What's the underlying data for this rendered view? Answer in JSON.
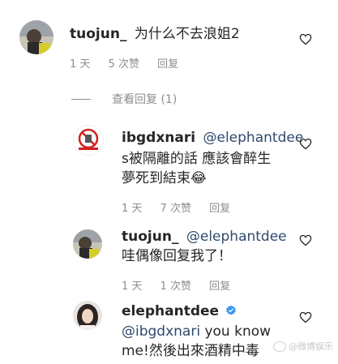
{
  "comments": [
    {
      "username": "tuojun_",
      "text": "为什么不去浪姐2",
      "time": "1 天",
      "likes": "5 次赞",
      "reply": "回复"
    }
  ],
  "view_replies": "查看回复 (1)",
  "replies": [
    {
      "username": "ibgdxnari",
      "mention": "@elephantdee",
      "line1_rest": "",
      "line2": "s被隔離的話 應該會醉生",
      "line3": "夢死到結束😂",
      "time": "1 天",
      "likes": "7 次赞",
      "reply": "回复"
    },
    {
      "username": "tuojun_",
      "mention": "@elephantdee",
      "line2": "哇偶像回复我了！",
      "time": "1 天",
      "likes": "1 次赞",
      "reply": "回复"
    },
    {
      "username": "elephantdee",
      "verified": true,
      "mention": "@ibgdxnari",
      "line2_rest": " you know",
      "line3": "me!然後出來酒精中毒"
    }
  ],
  "watermark": "@微博娱乐",
  "colors": {
    "mention": "#2f4a6e",
    "meta": "#8e8e8e",
    "verified": "#3897f0"
  },
  "icons": [
    "heart-icon",
    "verified-badge-icon"
  ]
}
